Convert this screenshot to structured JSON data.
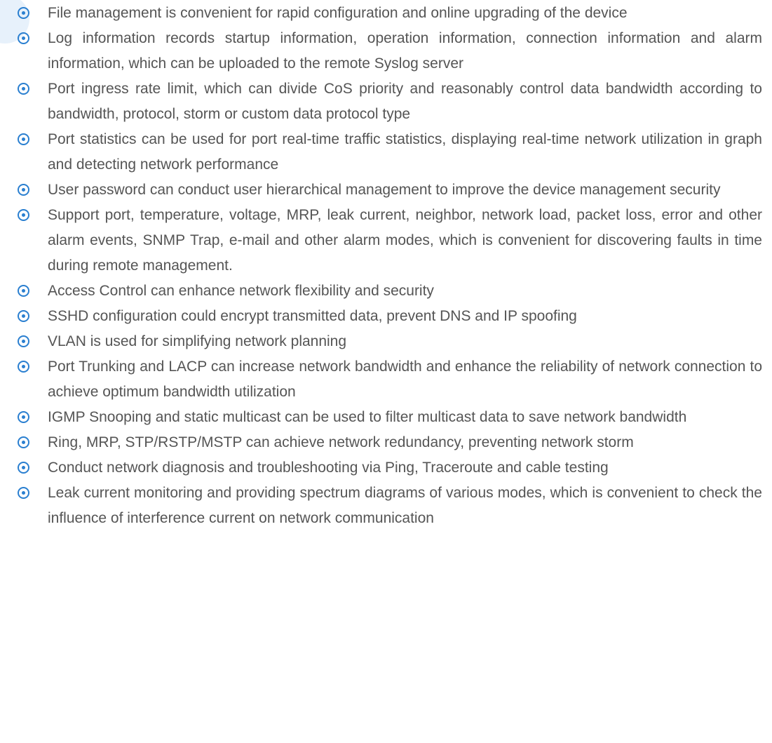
{
  "theme": {
    "bullet_color": "#2a7fd0",
    "text_color": "#555555",
    "corner_shape_color": "#e7f1fb"
  },
  "bullet_icon": "circled-dot-bullet-icon",
  "features": [
    "File management is convenient for rapid configuration and online upgrading of the device",
    "Log information records startup information, operation information, connection information and alarm information, which can be uploaded to the remote Syslog server",
    "Port ingress rate limit, which can divide CoS priority and reasonably control data bandwidth according to bandwidth, protocol, storm or custom data protocol type",
    "Port statistics can be used for port real-time traffic statistics, displaying real-time network utilization in graph and detecting network performance",
    "User password can conduct user hierarchical management to improve the device management security",
    "Support port, temperature, voltage, MRP, leak current, neighbor, network load, packet loss, error and other alarm events, SNMP Trap, e-mail and other alarm modes, which is convenient for discovering faults in time during remote management.",
    "Access Control can enhance network flexibility and security",
    "SSHD configuration could encrypt transmitted data, prevent DNS and IP spoofing",
    "VLAN is used for simplifying network planning",
    "Port Trunking and LACP can increase network bandwidth and enhance the reliability of network connection to achieve optimum bandwidth utilization",
    "IGMP Snooping and static multicast can be used to filter multicast data to save network bandwidth",
    "Ring, MRP, STP/RSTP/MSTP can achieve network redundancy, preventing network storm",
    "Conduct network diagnosis and troubleshooting via Ping, Traceroute and cable testing",
    "Leak current monitoring and providing spectrum diagrams of various modes, which is convenient to check the influence of interference current on network communication"
  ]
}
